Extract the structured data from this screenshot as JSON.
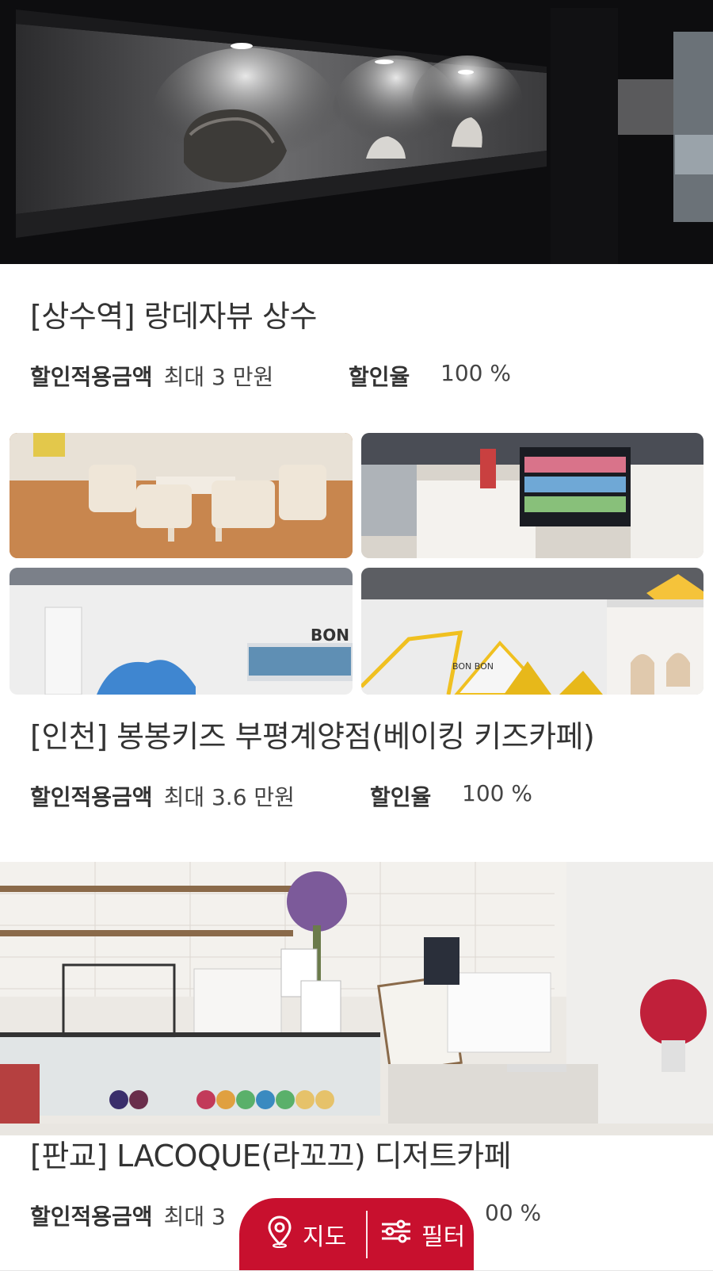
{
  "listings": [
    {
      "title": "[상수역] 랑데자뷰 상수",
      "discount_amount_label": "할인적용금액",
      "discount_amount_value": "최대 3 만원",
      "discount_rate_label": "할인율",
      "discount_rate_value": "100 %"
    },
    {
      "title": "[인천] 봉봉키즈 부평계양점(베이킹 키즈카페)",
      "discount_amount_label": "할인적용금액",
      "discount_amount_value": "최대 3.6 만원",
      "discount_rate_label": "할인율",
      "discount_rate_value": "100 %",
      "sign_text": "BON",
      "sign_text_2": "BON BON"
    },
    {
      "title": "[판교] LACOQUE(라꼬끄) 디저트카페",
      "discount_amount_label": "할인적용금액",
      "discount_amount_value": "최대 3",
      "discount_rate_value": "00 %"
    }
  ],
  "floating_bar": {
    "map_label": "지도",
    "filter_label": "필터",
    "color": "#c8102e"
  }
}
